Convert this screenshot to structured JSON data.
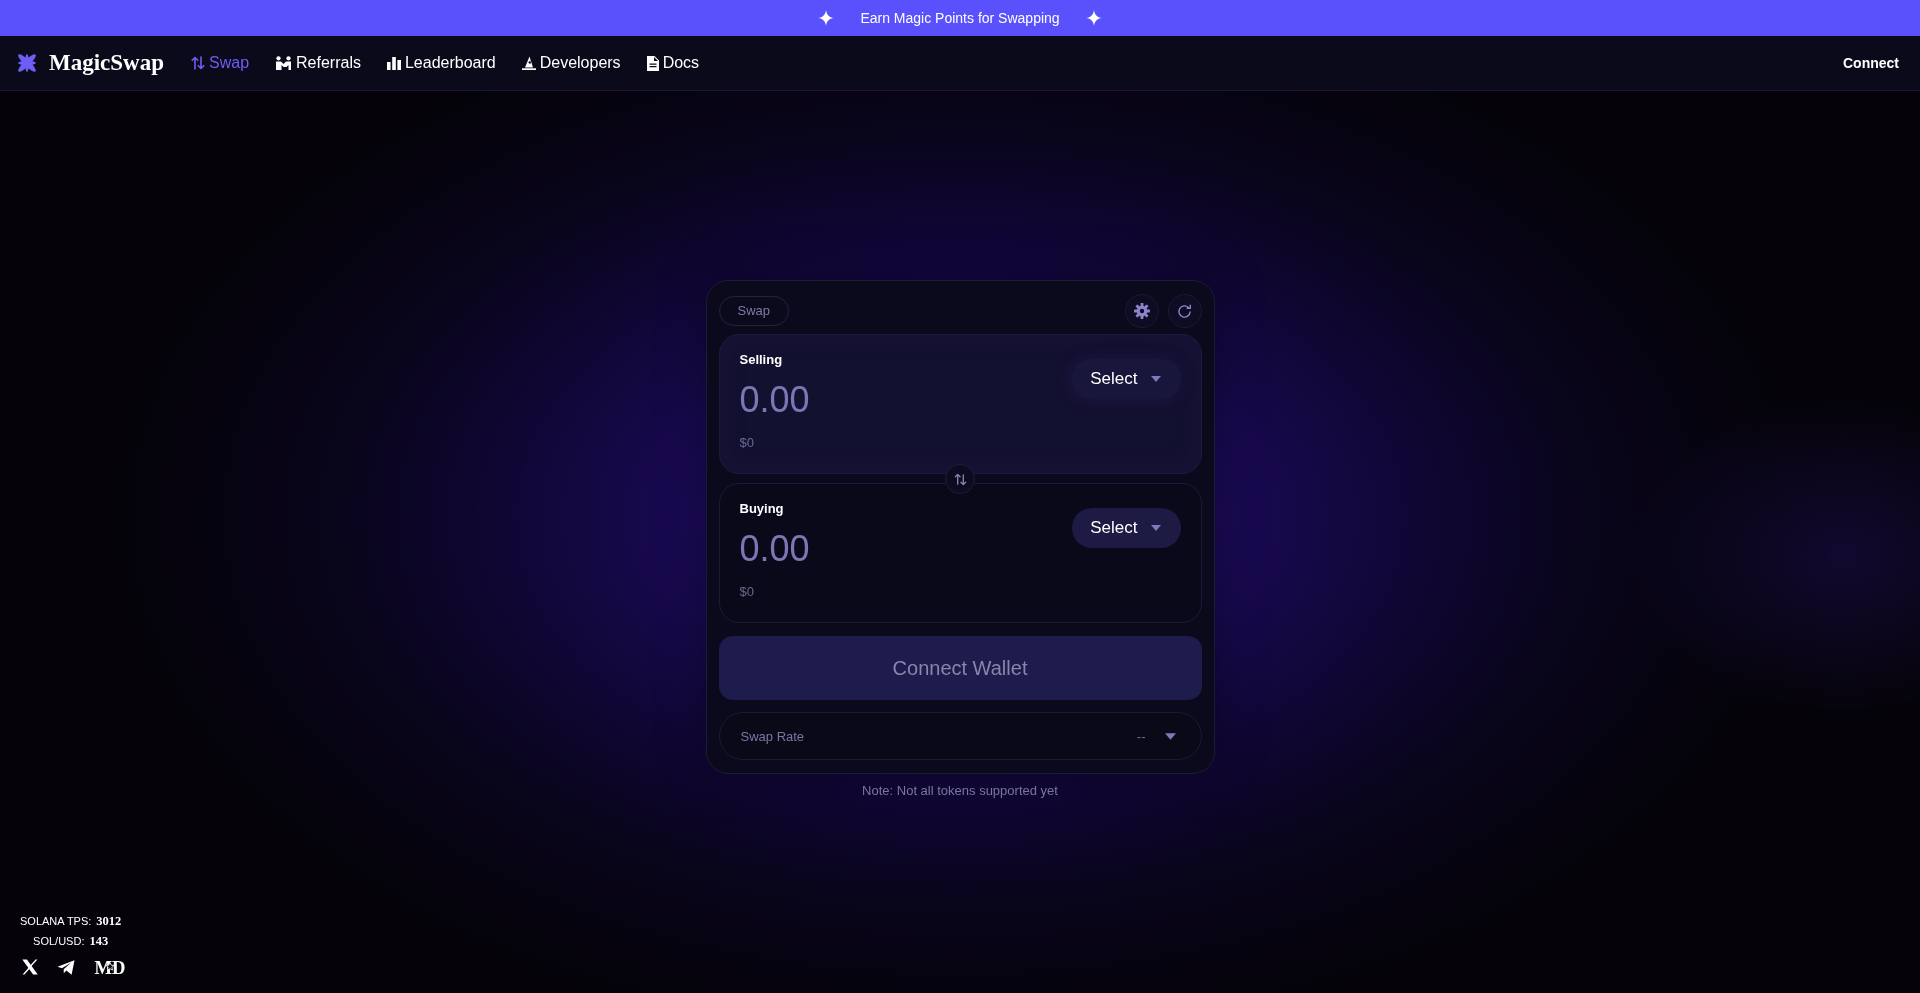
{
  "banner": {
    "text": "Earn Magic Points for Swapping"
  },
  "navbar": {
    "logo": "MagicSwap",
    "items": [
      {
        "label": "Swap",
        "selected": true
      },
      {
        "label": "Referrals",
        "selected": false
      },
      {
        "label": "Leaderboard",
        "selected": false
      },
      {
        "label": "Developers",
        "selected": false
      },
      {
        "label": "Docs",
        "selected": false
      }
    ],
    "connect": "Connect"
  },
  "swap_card": {
    "tab": "Swap",
    "panels": [
      {
        "label": "Selling",
        "highlighted": true,
        "amount": {
          "placeholder": "0.00"
        },
        "usd_value": "$0",
        "token_select": "Select"
      },
      {
        "label": "Buying",
        "highlighted": false,
        "amount": {
          "placeholder": "0.00"
        },
        "usd_value": "$0",
        "token_select": "Select"
      }
    ],
    "connect_wallet": "Connect Wallet",
    "swap_rate": {
      "label": "Swap Rate",
      "value": "--",
      "expanded": false
    }
  },
  "note": "Note: Not all tokens supported yet",
  "footer": {
    "stats": [
      {
        "label": "SOLANA TPS:",
        "value": "3012"
      },
      {
        "label": "SOL/USD:",
        "value": "143"
      }
    ],
    "brand_mark": "MD"
  }
}
